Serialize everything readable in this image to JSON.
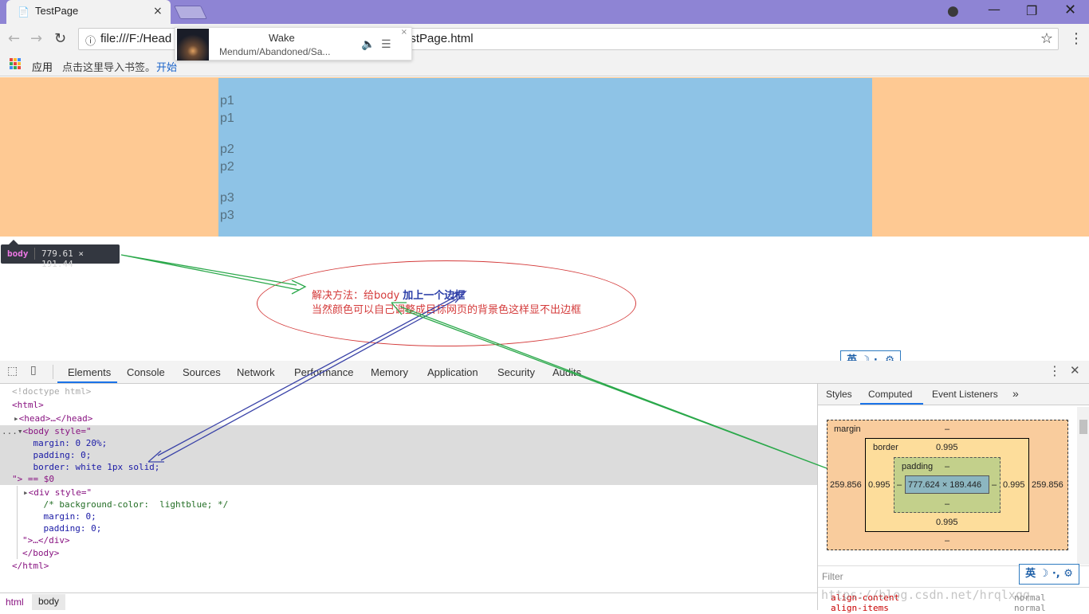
{
  "browser": {
    "tab_title": "TestPage",
    "tab_close": "×",
    "url_left": "file:///F:/Head",
    "url_right": "estPage.html",
    "bookmarks": {
      "apps": "应用",
      "import": "点击这里导入书签。",
      "start": "开始"
    },
    "accent_color": "#8e84d4"
  },
  "media": {
    "song": "Wake",
    "artist": "Mendum/Abandoned/Sa...",
    "close": "×"
  },
  "page": {
    "paragraphs": [
      "p1",
      "p1",
      "p2",
      "p2",
      "p3",
      "p3"
    ],
    "body_color": "#fec993",
    "div_color": "#8ec3e6"
  },
  "tooltip": {
    "tag": "body",
    "size": "779.61 × 191.44"
  },
  "annotation": {
    "line1_red": "解决方法：给body ",
    "line1_blue": "加上一个边框",
    "line2": "当然颜色可以自己调整成目标网页的背景色这样显不出边框"
  },
  "ime": {
    "label": "英",
    "icons": "☽ ·, ⚙"
  },
  "devtools": {
    "tabs": [
      "Elements",
      "Console",
      "Sources",
      "Network",
      "Performance",
      "Memory",
      "Application",
      "Security",
      "Audits"
    ],
    "active_tab": "Elements",
    "code": {
      "doctype": "<!doctype html>",
      "html_open": "<html>",
      "head": "<head>…</head>",
      "body_open": "<body style=\"",
      "body_margin": "    margin: 0 20%;",
      "body_padding": "    padding: 0;",
      "body_border": "    border: white 1px solid;",
      "body_close": "\"> == $0",
      "div_open": "<div style=\"",
      "div_comment": "    /* background-color:  lightblue; */",
      "div_margin": "    margin: 0;",
      "div_padding": "    padding: 0;",
      "div_close": "\">…</div>",
      "body_end": "</body>",
      "html_end": "</html>",
      "ellipsis": "..."
    },
    "breadcrumbs": [
      "html",
      "body"
    ],
    "sidebar_tabs": [
      "Styles",
      "Computed",
      "Event Listeners",
      "»"
    ],
    "sidebar_active": "Computed",
    "boxmodel": {
      "margin_label": "margin",
      "margin_top": "–",
      "margin_bottom": "–",
      "margin_left": "259.856",
      "margin_right": "259.856",
      "border_label": "border",
      "border_top": "0.995",
      "border_bottom": "0.995",
      "border_left": "0.995",
      "border_right": "0.995",
      "padding_label": "padding",
      "padding_top": "–",
      "padding_bottom": "–",
      "padding_left": "–",
      "padding_right": "–",
      "content": "777.624 × 189.446"
    },
    "filter_placeholder": "Filter",
    "computed_props": [
      {
        "name": "align-content",
        "value": "normal"
      },
      {
        "name": "align-items",
        "value": "normal"
      }
    ],
    "watermark": "https://blog.csdn.net/hrqlxqq"
  }
}
